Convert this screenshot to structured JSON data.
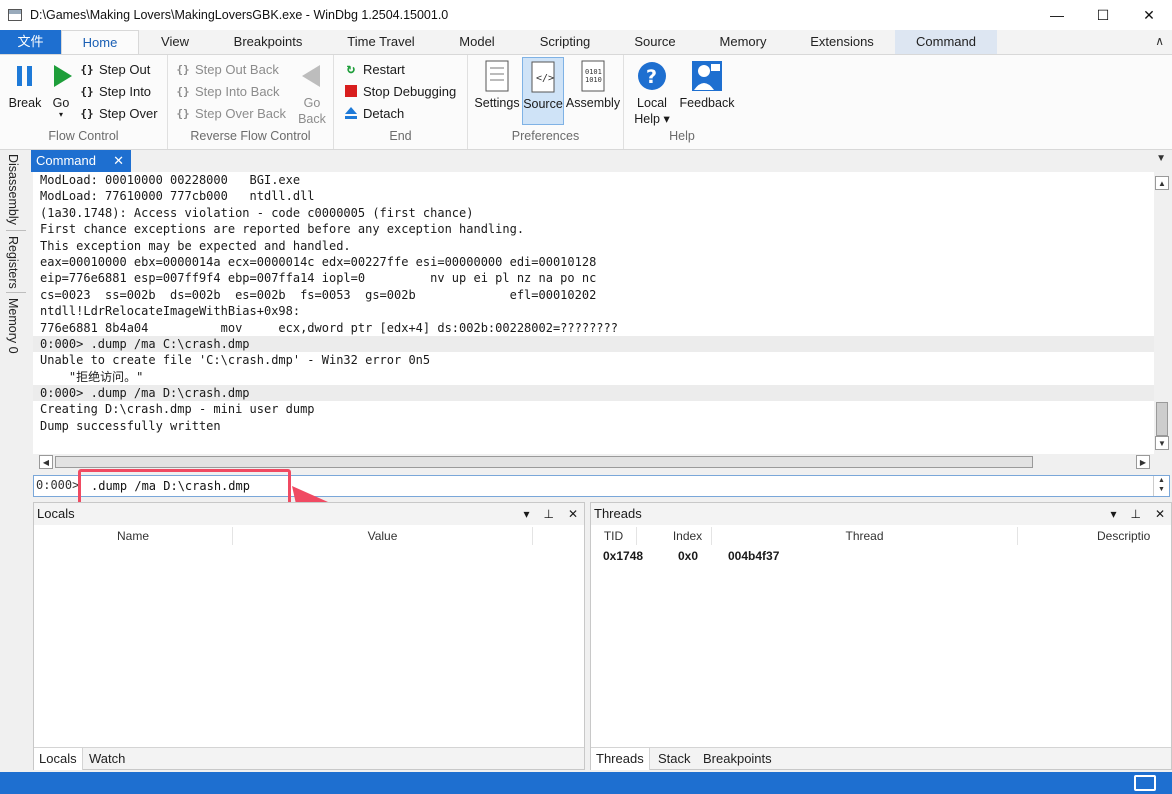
{
  "window": {
    "title": "D:\\Games\\Making Lovers\\MakingLoversGBK.exe  - WinDbg 1.2504.15001.0",
    "minimize": "—",
    "maximize": "☐",
    "close": "✕"
  },
  "ribbon": {
    "tabs": [
      "文件",
      "Home",
      "View",
      "Breakpoints",
      "Time Travel",
      "Model",
      "Scripting",
      "Source",
      "Memory",
      "Extensions",
      "Command"
    ],
    "collapse": "∧",
    "flow_control": {
      "label": "Flow Control",
      "break": "Break",
      "go": "Go",
      "step_out": "Step Out",
      "step_into": "Step Into",
      "step_over": "Step Over"
    },
    "reverse_flow": {
      "label": "Reverse Flow Control",
      "step_out_back": "Step Out Back",
      "step_into_back": "Step Into Back",
      "step_over_back": "Step Over Back",
      "go_back_1": "Go",
      "go_back_2": "Back"
    },
    "end": {
      "label": "End",
      "restart": "Restart",
      "stop": "Stop Debugging",
      "detach": "Detach"
    },
    "preferences": {
      "label": "Preferences",
      "settings": "Settings",
      "source": "Source",
      "assembly": "Assembly"
    },
    "help": {
      "label": "Help",
      "local_help_1": "Local",
      "local_help_2": "Help ▾",
      "feedback": "Feedback"
    }
  },
  "side_tabs": [
    "Disassembly",
    "Registers",
    "Memory 0"
  ],
  "command": {
    "tab_label": "Command",
    "tab_close": "✕",
    "menu": "▼",
    "lines": [
      {
        "text": "ModLoad: 00010000 00228000   BGI.exe",
        "shade": false
      },
      {
        "text": "ModLoad: 77610000 777cb000   ntdll.dll",
        "shade": false
      },
      {
        "text": "(1a30.1748): Access violation - code c0000005 (first chance)",
        "shade": false
      },
      {
        "text": "First chance exceptions are reported before any exception handling.",
        "shade": false
      },
      {
        "text": "This exception may be expected and handled.",
        "shade": false
      },
      {
        "text": "eax=00010000 ebx=0000014a ecx=0000014c edx=00227ffe esi=00000000 edi=00010128",
        "shade": false
      },
      {
        "text": "eip=776e6881 esp=007ff9f4 ebp=007ffa14 iopl=0         nv up ei pl nz na po nc",
        "shade": false
      },
      {
        "text": "cs=0023  ss=002b  ds=002b  es=002b  fs=0053  gs=002b             efl=00010202",
        "shade": false
      },
      {
        "text": "ntdll!LdrRelocateImageWithBias+0x98:",
        "shade": false
      },
      {
        "text": "776e6881 8b4a04          mov     ecx,dword ptr [edx+4] ds:002b:00228002=????????",
        "shade": false
      },
      {
        "text": "0:000> .dump /ma C:\\crash.dmp",
        "shade": true
      },
      {
        "text": "Unable to create file 'C:\\crash.dmp' - Win32 error 0n5",
        "shade": false
      },
      {
        "text": "    \"拒绝访问。\"",
        "shade": false
      },
      {
        "text": "0:000> .dump /ma D:\\crash.dmp",
        "shade": true
      },
      {
        "text": "Creating D:\\crash.dmp - mini user dump",
        "shade": false
      },
      {
        "text": "Dump successfully written",
        "shade": false
      }
    ],
    "prompt": "0:000>",
    "input_value": ".dump /ma D:\\crash.dmp"
  },
  "locals": {
    "title": "Locals",
    "columns": [
      "Name",
      "Value"
    ],
    "tabs": [
      "Locals",
      "Watch"
    ]
  },
  "threads": {
    "title": "Threads",
    "columns": [
      "TID",
      "Index",
      "Thread",
      "Descriptio"
    ],
    "rows": [
      {
        "tid": "0x1748",
        "index": "0x0",
        "thread": "004b4f37"
      }
    ],
    "tabs": [
      "Threads",
      "Stack",
      "Breakpoints"
    ]
  },
  "pane_controls": {
    "dropdown": "▾",
    "pin": "⊥",
    "close": "✕"
  },
  "colors": {
    "accent": "#1e6fd0",
    "highlight": "#f04a62"
  }
}
